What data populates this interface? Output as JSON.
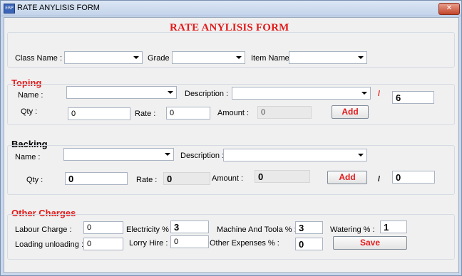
{
  "window": {
    "title": "RATE ANYLISIS FORM",
    "icon_label": "ERP",
    "close_symbol": "✕"
  },
  "form_title": "RATE ANYLISIS FORM",
  "header_filters": {
    "class_name_label": "Class Name :",
    "class_name_value": "",
    "grade_label": "Grade :",
    "grade_value": "",
    "item_name_label": "Item Name :",
    "item_name_value": ""
  },
  "toping": {
    "title": "Toping",
    "name_label": "Name :",
    "name_value": "",
    "description_label": "Description :",
    "description_value": "",
    "slash": "/",
    "divisor_value": "6",
    "qty_label": "Qty :",
    "qty_value": "0",
    "rate_label": "Rate :",
    "rate_value": "0",
    "amount_label": "Amount :",
    "amount_value": "0",
    "add_label": "Add"
  },
  "backing": {
    "title": "Backing",
    "name_label": "Name :",
    "name_value": "",
    "description_label": "Description :",
    "description_value": "",
    "qty_label": "Qty :",
    "qty_value": "0",
    "rate_label": "Rate :",
    "rate_value": "0",
    "amount_label": "Amount :",
    "amount_value": "0",
    "add_label": "Add",
    "slash": "/",
    "divisor_value": "0"
  },
  "other_charges": {
    "title": "Other Charges",
    "labour_charge_label": "Labour Charge :",
    "labour_charge_value": "0",
    "electricity_label": "Electricity % :",
    "electricity_value": "3",
    "machine_label": "Machine And Toola % :",
    "machine_value": "3",
    "watering_label": "Watering % :",
    "watering_value": "1",
    "loading_label": "Loading unloading :",
    "loading_value": "0",
    "lorry_hire_label": "Lorry Hire :",
    "lorry_hire_value": "0",
    "other_expenses_label": "Other Expenses % :",
    "other_expenses_value": "0",
    "save_label": "Save"
  },
  "colors": {
    "accent_red": "#e31a1a",
    "title_bar": "#c3d3ea",
    "close_button": "#c2452a"
  }
}
